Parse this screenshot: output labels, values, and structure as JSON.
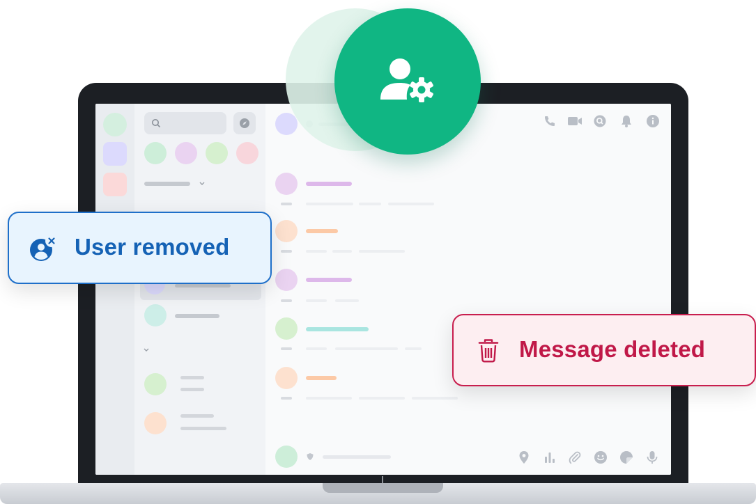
{
  "notifications": {
    "user_removed": {
      "label": "User removed",
      "icon": "user-removed-icon",
      "color": "#1562b5"
    },
    "message_deleted": {
      "label": "Message deleted",
      "icon": "trash-icon",
      "color": "#c01848"
    }
  },
  "badge": {
    "icon": "user-settings-icon",
    "color": "#10b683"
  },
  "header_icons": [
    "phone-icon",
    "video-icon",
    "search-icon",
    "bell-icon",
    "info-icon"
  ],
  "composer_icons": [
    "location-icon",
    "poll-icon",
    "attachment-icon",
    "emoji-icon",
    "sticker-icon",
    "microphone-icon"
  ],
  "colors": {
    "green": "#cdeed9",
    "purple": "#ddd3f1",
    "peach": "#fde1cf",
    "pink": "#f8d6dc",
    "teal": "#cdeee8",
    "lavender": "#dcdafd",
    "bezel": "#1c1f24"
  }
}
